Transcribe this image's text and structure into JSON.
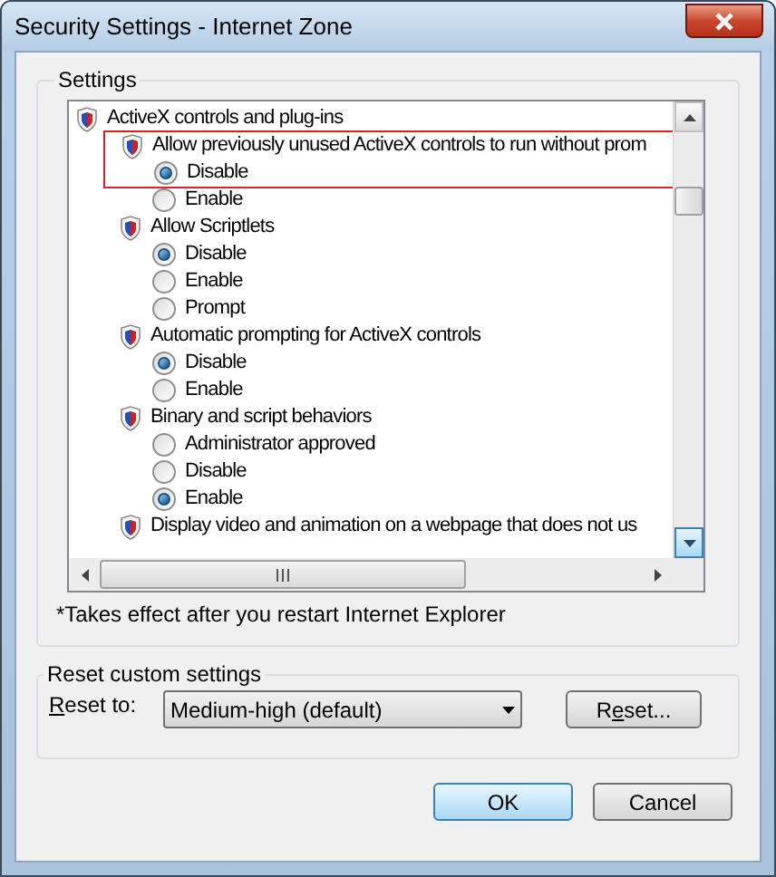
{
  "window": {
    "title": "Security Settings - Internet Zone"
  },
  "settings": {
    "title": "Settings",
    "tree": [
      {
        "label": "ActiveX controls and plug-ins",
        "children": [
          {
            "label": "Allow previously unused ActiveX controls to run without prom",
            "highlighted": true,
            "children": [
              {
                "label": "Disable",
                "selected": true
              },
              {
                "label": "Enable",
                "selected": false
              }
            ]
          },
          {
            "label": "Allow Scriptlets",
            "highlighted": false,
            "children": [
              {
                "label": "Disable",
                "selected": true
              },
              {
                "label": "Enable",
                "selected": false
              },
              {
                "label": "Prompt",
                "selected": false
              }
            ]
          },
          {
            "label": "Automatic prompting for ActiveX controls",
            "highlighted": false,
            "children": [
              {
                "label": "Disable",
                "selected": true
              },
              {
                "label": "Enable",
                "selected": false
              }
            ]
          },
          {
            "label": "Binary and script behaviors",
            "highlighted": false,
            "children": [
              {
                "label": "Administrator approved",
                "selected": false
              },
              {
                "label": "Disable",
                "selected": false
              },
              {
                "label": "Enable",
                "selected": true
              }
            ]
          },
          {
            "label": "Display video and animation on a webpage that does not us",
            "highlighted": false
          }
        ]
      }
    ],
    "note": "*Takes effect after you restart Internet Explorer"
  },
  "reset": {
    "title": "Reset custom settings",
    "label": {
      "key": "R",
      "after": "eset to:"
    },
    "dropdown": {
      "value": "Medium-high (default)"
    },
    "button": {
      "before": "R",
      "key": "e",
      "after": "set..."
    }
  },
  "buttons": [
    {
      "label": "OK",
      "default": true
    },
    {
      "label": "Cancel",
      "default": false
    }
  ]
}
